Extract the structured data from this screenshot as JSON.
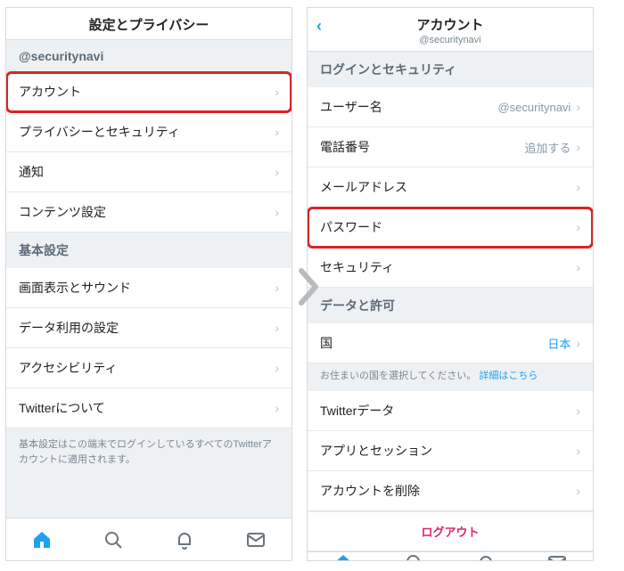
{
  "left": {
    "title": "設定とプライバシー",
    "userSection": "@securitynavi",
    "rows1": [
      {
        "label": "アカウント",
        "highlight": true
      },
      {
        "label": "プライバシーとセキュリティ"
      },
      {
        "label": "通知"
      },
      {
        "label": "コンテンツ設定"
      }
    ],
    "basicTitle": "基本設定",
    "rows2": [
      {
        "label": "画面表示とサウンド"
      },
      {
        "label": "データ利用の設定"
      },
      {
        "label": "アクセシビリティ"
      },
      {
        "label": "Twitterについて"
      }
    ],
    "footnote": "基本設定はこの端末でログインしているすべてのTwitterアカウントに適用されます。"
  },
  "right": {
    "title": "アカウント",
    "subtitle": "@securitynavi",
    "loginSecTitle": "ログインとセキュリティ",
    "rows1": [
      {
        "label": "ユーザー名",
        "value": "@securitynavi"
      },
      {
        "label": "電話番号",
        "value": "追加する"
      },
      {
        "label": "メールアドレス"
      },
      {
        "label": "パスワード",
        "highlight": true
      },
      {
        "label": "セキュリティ"
      }
    ],
    "dataPermTitle": "データと許可",
    "rows2": [
      {
        "label": "国",
        "value": "日本"
      }
    ],
    "countryNote": "お住まいの国を選択してください。",
    "countryNoteLink": "詳細はこちら",
    "rows3": [
      {
        "label": "Twitterデータ"
      },
      {
        "label": "アプリとセッション"
      }
    ],
    "rows4": [
      {
        "label": "アカウントを削除"
      }
    ],
    "logout": "ログアウト"
  }
}
